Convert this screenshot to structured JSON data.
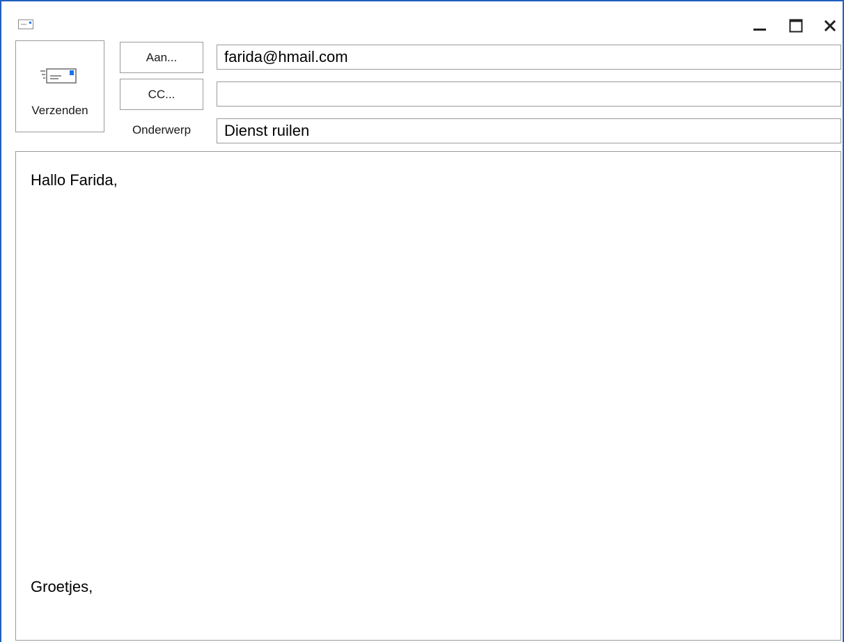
{
  "window": {
    "icon": "envelope-icon",
    "controls": {
      "minimize": "minimize-icon",
      "maximize": "maximize-icon",
      "close": "close-icon"
    },
    "border_color": "#1f5fbf"
  },
  "toolbar": {
    "send_label": "Verzenden",
    "send_icon": "send-mail-icon",
    "accent_color": "#1a73e8"
  },
  "header": {
    "to_button": "Aan...",
    "cc_button": "CC...",
    "subject_label": "Onderwerp",
    "to_value": "farida@hmail.com",
    "cc_value": "",
    "subject_value": "Dienst ruilen"
  },
  "message": {
    "greeting": "Hallo Farida,",
    "closing": "Groetjes,"
  }
}
